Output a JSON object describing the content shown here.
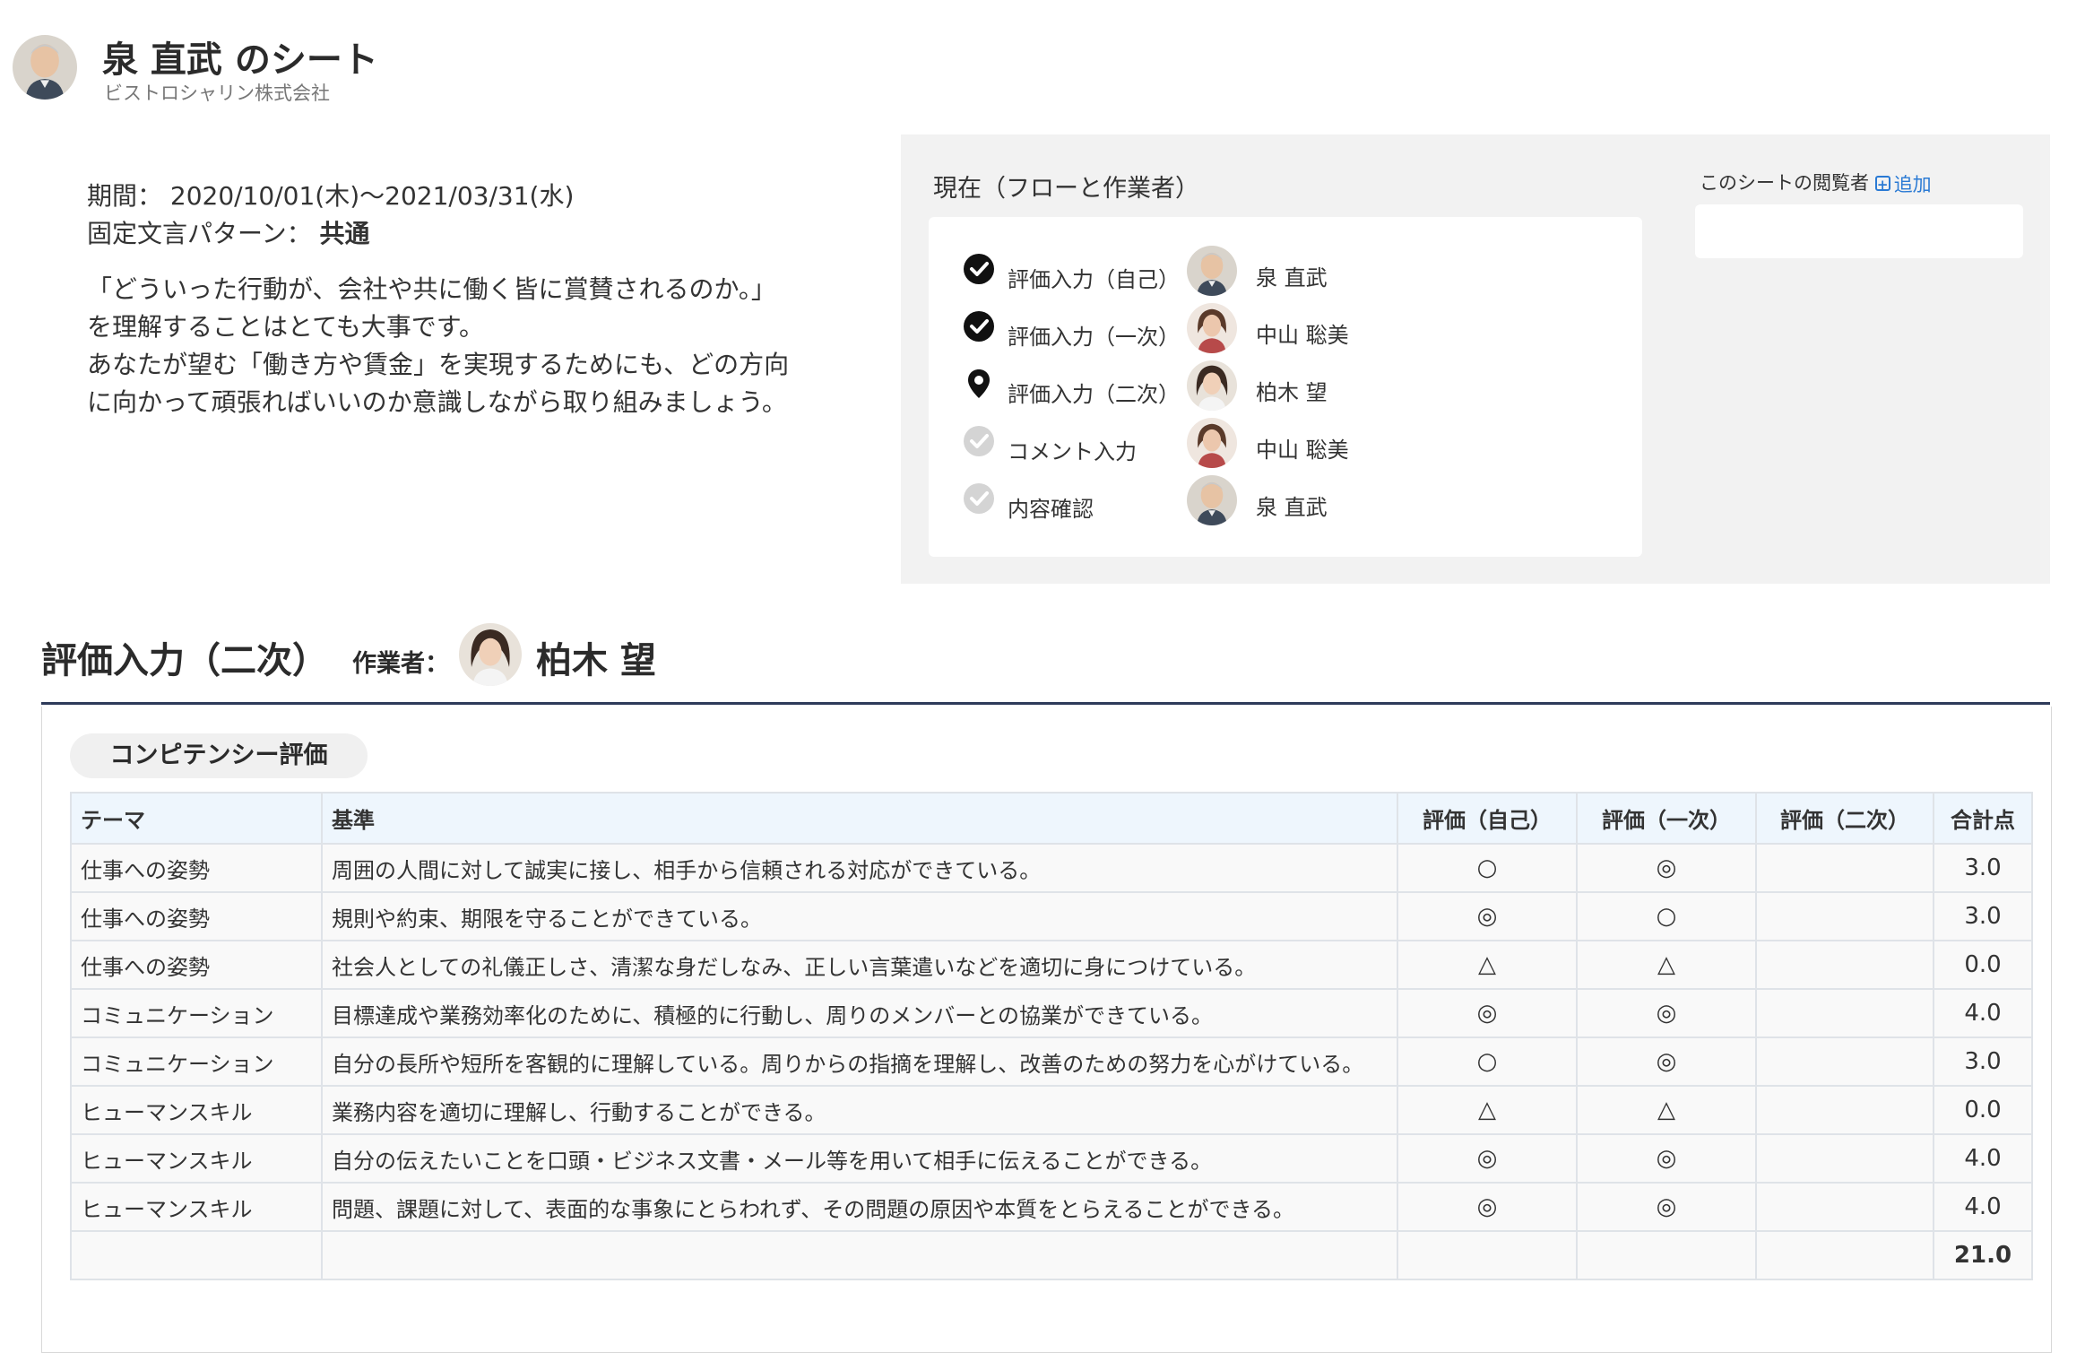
{
  "header": {
    "title": "泉 直武 のシート",
    "company": "ビストロシャリン株式会社"
  },
  "info": {
    "period_label": "期間：",
    "period_value": "2020/10/01(木)〜2021/03/31(水)",
    "pattern_label": "固定文言パターン：",
    "pattern_value": "共通",
    "description": "「どういった行動が、会社や共に働く皆に賞賛されるのか。」\nを理解することはとても大事です。\nあなたが望む「働き方や賃金」を実現するためにも、どの方向\nに向かって頑張ればいいのか意識しながら取り組みましょう。"
  },
  "flow": {
    "title": "現在（フローと作業者）",
    "steps": [
      {
        "status": "done",
        "icon": "check-circle-icon",
        "label": "評価入力（自己）",
        "person": "泉 直武",
        "avatar": "elder-man"
      },
      {
        "status": "done",
        "icon": "check-circle-icon",
        "label": "評価入力（一次）",
        "person": "中山 聡美",
        "avatar": "woman-a"
      },
      {
        "status": "current",
        "icon": "map-pin-icon",
        "label": "評価入力（二次）",
        "person": "柏木 望",
        "avatar": "woman-b"
      },
      {
        "status": "pending",
        "icon": "check-circle-icon",
        "label": "コメント入力",
        "person": "中山 聡美",
        "avatar": "woman-a"
      },
      {
        "status": "pending",
        "icon": "check-circle-icon",
        "label": "内容確認",
        "person": "泉 直武",
        "avatar": "elder-man"
      }
    ]
  },
  "viewers": {
    "label": "このシートの閲覧者",
    "add_label": "追加"
  },
  "section": {
    "title": "評価入力（二次）",
    "worker_label": "作業者：",
    "worker_name": "柏木 望"
  },
  "table": {
    "tab_label": "コンピテンシー評価",
    "headers": [
      "テーマ",
      "基準",
      "評価（自己）",
      "評価（一次）",
      "評価（二次）",
      "合計点"
    ],
    "rows": [
      [
        "仕事への姿勢",
        "周囲の人間に対して誠実に接し、相手から信頼される対応ができている。",
        "○",
        "◎",
        "",
        "3.0"
      ],
      [
        "仕事への姿勢",
        "規則や約束、期限を守ることができている。",
        "◎",
        "○",
        "",
        "3.0"
      ],
      [
        "仕事への姿勢",
        "社会人としての礼儀正しさ、清潔な身だしなみ、正しい言葉遣いなどを適切に身につけている。",
        "△",
        "△",
        "",
        "0.0"
      ],
      [
        "コミュニケーション",
        "目標達成や業務効率化のために、積極的に行動し、周りのメンバーとの協業ができている。",
        "◎",
        "◎",
        "",
        "4.0"
      ],
      [
        "コミュニケーション",
        "自分の長所や短所を客観的に理解している。周りからの指摘を理解し、改善のための努力を心がけている。",
        "○",
        "◎",
        "",
        "3.0"
      ],
      [
        "ヒューマンスキル",
        "業務内容を適切に理解し、行動することができる。",
        "△",
        "△",
        "",
        "0.0"
      ],
      [
        "ヒューマンスキル",
        "自分の伝えたいことを口頭・ビジネス文書・メール等を用いて相手に伝えることができる。",
        "◎",
        "◎",
        "",
        "4.0"
      ],
      [
        "ヒューマンスキル",
        "問題、課題に対して、表面的な事象にとらわれず、その問題の原因や本質をとらえることができる。",
        "◎",
        "◎",
        "",
        "4.0"
      ]
    ],
    "total": "21.0"
  },
  "colors": {
    "accent": "#2a7ad4",
    "header_rule": "#2e3b5a",
    "panel_bg": "#f2f2f2",
    "table_header_bg": "#eef6fd"
  }
}
